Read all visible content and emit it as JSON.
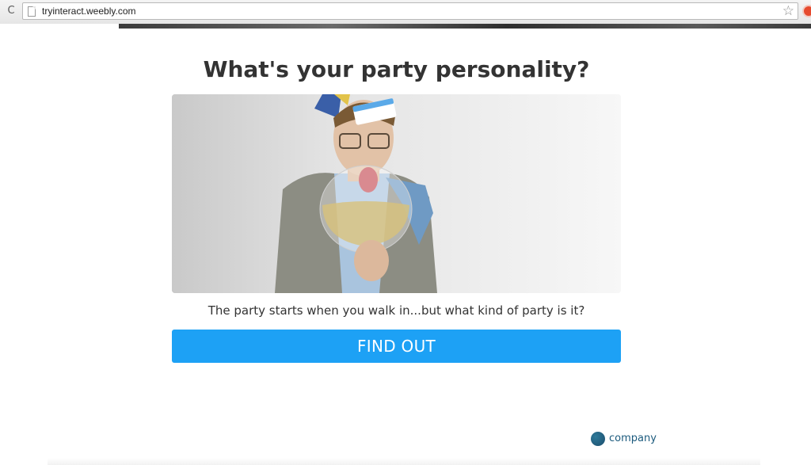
{
  "browser": {
    "url": "tryinteract.weebly.com",
    "reload_glyph": "C",
    "star_glyph": "☆"
  },
  "quiz": {
    "title": "What's your party personality?",
    "subtitle": "The party starts when you walk in...but what kind of party is it?",
    "cta_label": "FIND OUT",
    "cta_color": "#1da1f5"
  },
  "branding": {
    "label": "company",
    "color": "#1b5a7d"
  },
  "icons": {
    "reload": "reload-icon",
    "page": "page-icon",
    "star": "bookmark-star-icon",
    "extension": "extension-icon",
    "brand": "company-logo-icon"
  }
}
